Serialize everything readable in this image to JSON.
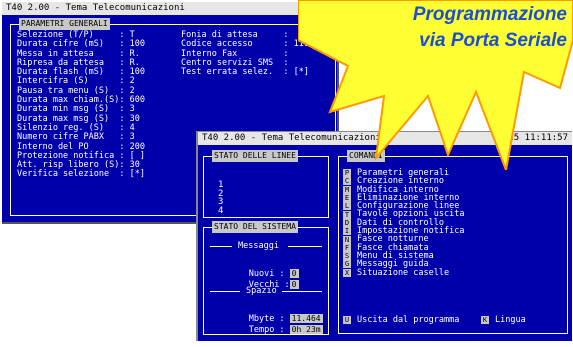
{
  "back_window": {
    "title": "T40 2.00 - Tema Telecomunicazioni",
    "panel_title": "PARAMETRI GENERALI",
    "left_rows": [
      "Selezione (T/P)     : T",
      "Durata cifre (mS)   : 100",
      "Messa in attesa     : R.",
      "Ripresa da attesa   : R.",
      "Durata flash (mS)   : 100",
      "Intercifra (S)      : 2",
      "Pausa tra menu (S)  : 2",
      "Durata max chiam.(S): 600",
      "Durata min msg (S)  : 3",
      "Durata max msg (S)  : 30",
      "Silenzio reg. (S)   : 4",
      "Numero cifre PABX   : 3",
      "Interno del PO      : 200",
      "Protezione notifica : [ ]",
      "Att. risp libero (S): 30",
      "Verifica selezione  : [*]"
    ],
    "right_rows": [
      "Fonia di attesa     :",
      "Codice accesso      : 1111",
      "Interno Fax         :",
      "Centro servizi SMS  :",
      "Test errata selez.  : [*]"
    ]
  },
  "front_window": {
    "title": "T40 2.00 - Tema Telecomunicazioni",
    "title_right": "25     11:11:57",
    "linee": {
      "title": "STATO DELLE LINEE",
      "items": [
        "1",
        "2",
        "3",
        "4"
      ]
    },
    "sistema": {
      "title": "STATO DEL SISTEMA",
      "messaggi_label": "Messaggi",
      "nuovi_label": "Nuovi :",
      "nuovi_value": "0",
      "vecchi_label": "Vecchi :",
      "vecchi_value": "0",
      "spazio_label": "Spazio",
      "mbyte_label": "Mbyte :",
      "mbyte_value": "11.464",
      "tempo_label": "Tempo :",
      "tempo_value": "0h 23m"
    },
    "comandi": {
      "title": "COMANDI",
      "items": [
        {
          "key": "P",
          "label": "Parametri generali"
        },
        {
          "key": "C",
          "label": "Creazione interno"
        },
        {
          "key": "M",
          "label": "Modifica interno"
        },
        {
          "key": "E",
          "label": "Eliminazione interno"
        },
        {
          "key": "L",
          "label": "Configurazione linee"
        },
        {
          "key": "T",
          "label": "Tavole opzioni uscita"
        },
        {
          "key": "D",
          "label": "Dati di controllo"
        },
        {
          "key": "I",
          "label": "Impostazione notifica"
        },
        {
          "key": "N",
          "label": "Fasce notturne"
        },
        {
          "key": "F",
          "label": "Fasce chiamata"
        },
        {
          "key": "S",
          "label": "Menu di sistema"
        },
        {
          "key": "G",
          "label": "Messaggi guida"
        },
        {
          "key": "X",
          "label": "Situazione caselle"
        }
      ],
      "exit_key": "U",
      "exit_label": "Uscita dal programma",
      "lang_key": "K",
      "lang_label": "Lingua"
    }
  },
  "promo": {
    "line1": "Programmazione",
    "line2": "via Porta Seriale",
    "burst_fill": "#ffff33",
    "burst_stroke": "#ff9900",
    "text_color": "#1a4fd0"
  }
}
